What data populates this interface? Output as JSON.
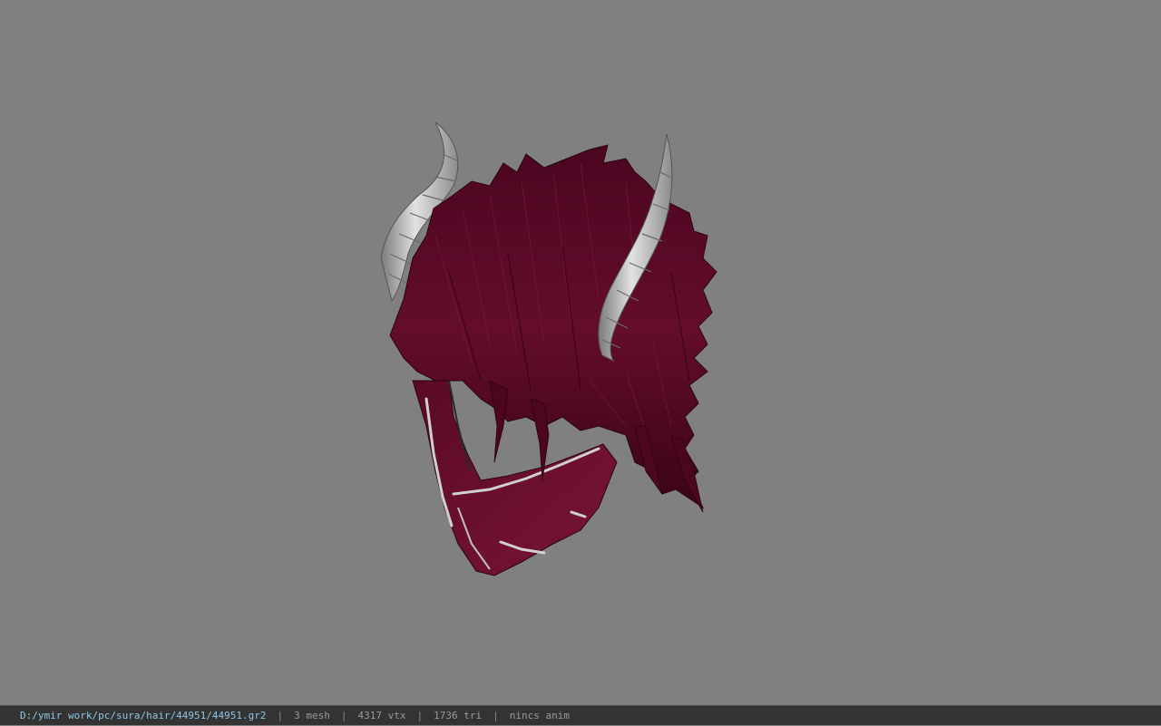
{
  "viewer": {
    "background_color": "#808080",
    "model_colors": {
      "hair": "#5c0a26",
      "hair_dark": "#2e0412",
      "horn": "#c8c8c8",
      "horn_dark": "#6e6e6e"
    }
  },
  "status_bar": {
    "file_path": "D:/ymir work/pc/sura/hair/44951/44951.gr2",
    "separator": "|",
    "mesh_count": "3 mesh",
    "vertex_count": "4317 vtx",
    "triangle_count": "1736 tri",
    "anim_state": "nincs anim"
  }
}
